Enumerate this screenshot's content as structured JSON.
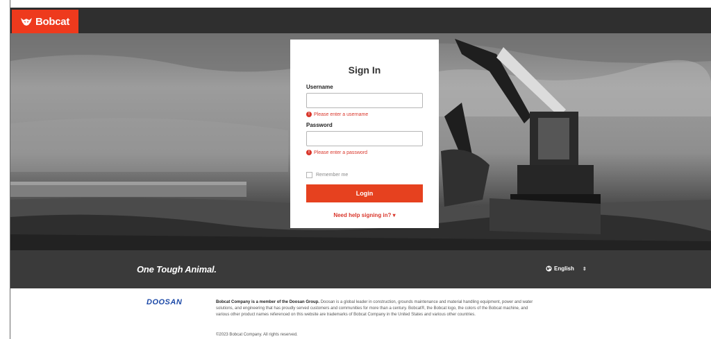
{
  "header": {
    "brand_name": "Bobcat",
    "brand_color": "#ee3a1d",
    "logo_icon": "bobcat-head-icon"
  },
  "signin": {
    "title": "Sign In",
    "username_label": "Username",
    "username_value": "",
    "username_error": "Please enter a username",
    "password_label": "Password",
    "password_value": "",
    "password_error": "Please enter a password",
    "remember_label": "Remember me",
    "login_label": "Login",
    "help_link": "Need help signing in? ▾",
    "error_color": "#d9362b",
    "button_color": "#e6411f"
  },
  "tagbar": {
    "tagline": "One Tough Animal.",
    "language": "English",
    "language_icon": "globe-icon",
    "language_arrow": "⇕"
  },
  "footer": {
    "doosan_logo": "DOOSAN",
    "lead": "Bobcat Company is a member of the Doosan Group.",
    "body": "Doosan is a global leader in construction, grounds maintenance and material handling equipment, power and water solutions, and engineering that has proudly served customers and communities for more than a century. Bobcat®, the Bobcat logo, the colors of the Bobcat machine, and various other product names referenced on this website are trademarks of Bobcat Company in the United States and various other countries.",
    "copyright": "©2023 Bobcat Company. All rights reserved."
  }
}
